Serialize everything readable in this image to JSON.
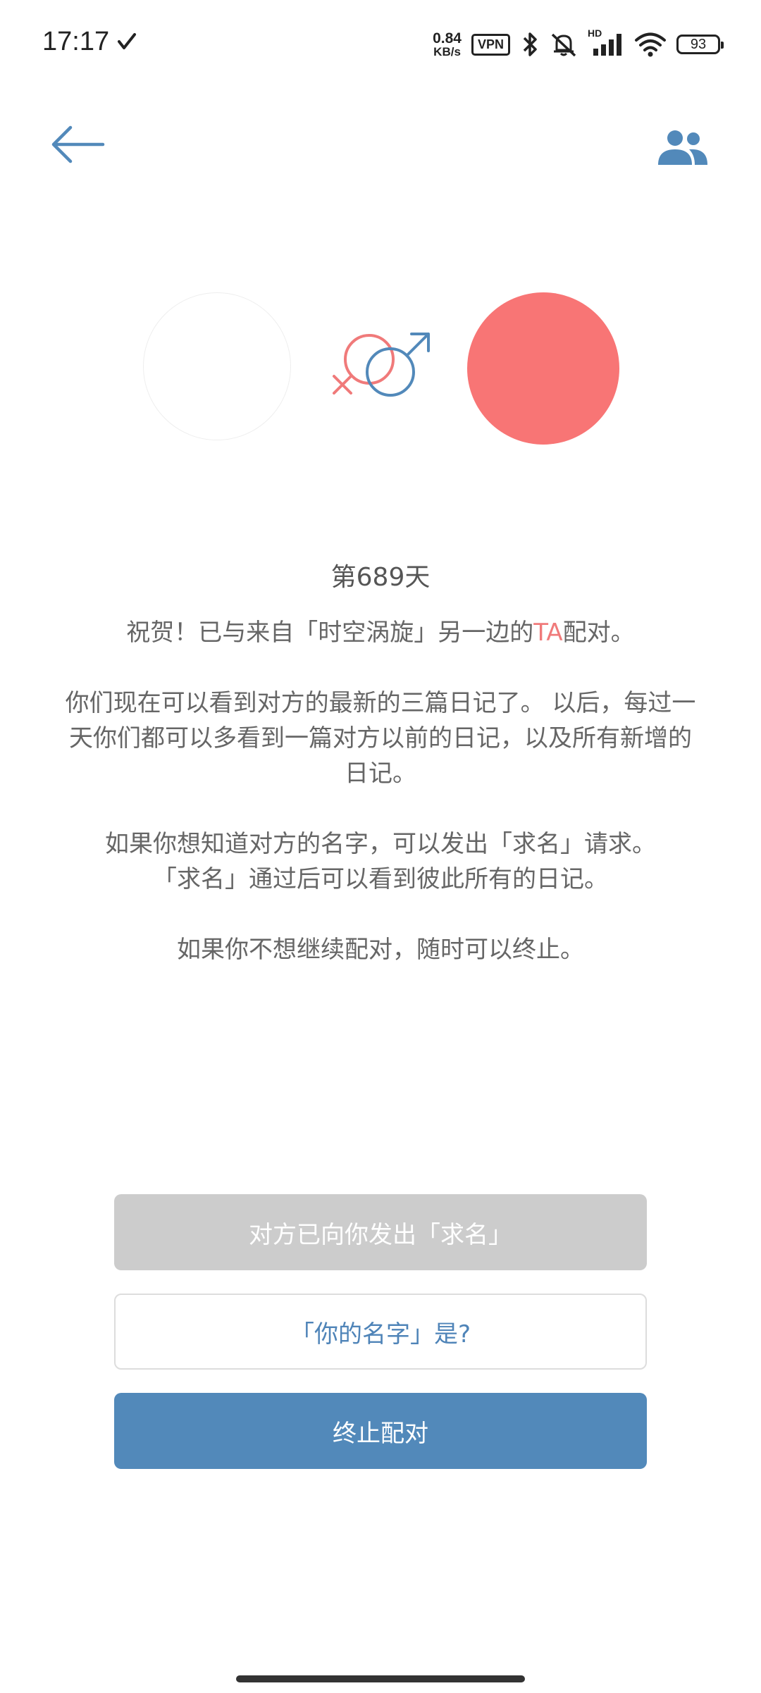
{
  "status_bar": {
    "time": "17:17",
    "net_speed_value": "0.84",
    "net_speed_unit": "KB/s",
    "vpn_label": "VPN",
    "signal_label": "HD",
    "battery_level": "93"
  },
  "top_bar": {
    "back_icon": "arrow-left-icon",
    "people_icon": "people-icon",
    "accent_color": "#5289ba"
  },
  "pairing": {
    "right_avatar_color": "#f87575",
    "day_count": "第689天",
    "congrats_prefix": "祝贺！已与来自「时空涡旋」另一边的",
    "congrats_highlight": "TA",
    "congrats_suffix": "配对。",
    "paragraph_1": "你们现在可以看到对方的最新的三篇日记了。 以后，每过一天你们都可以多看到一篇对方以前的日记，以及所有新增的日记。",
    "paragraph_2_line_1": "如果你想知道对方的名字，可以发出「求名」请求。",
    "paragraph_2_line_2": "「求名」通过后可以看到彼此所有的日记。",
    "paragraph_3": "如果你不想继续配对，随时可以终止。"
  },
  "actions": {
    "request_sent_label": "对方已向你发出「求名」",
    "your_name_label": "「你的名字」是?",
    "terminate_label": "终止配对"
  }
}
